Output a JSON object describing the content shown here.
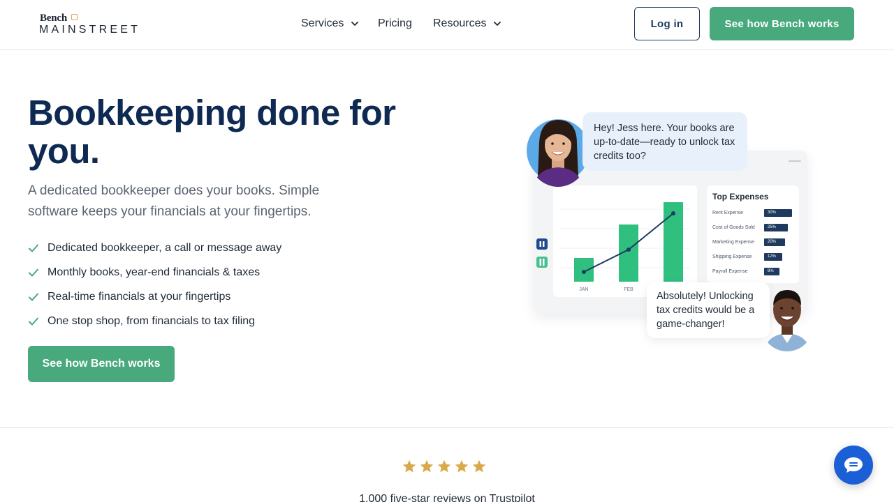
{
  "brand": {
    "top": "Bench",
    "bottom": "MAINSTREET"
  },
  "nav": {
    "services": "Services",
    "pricing": "Pricing",
    "resources": "Resources"
  },
  "header": {
    "login_label": "Log in",
    "cta_label": "See how Bench works"
  },
  "hero": {
    "title": "Bookkeeping done for you.",
    "subtitle": "A dedicated bookkeeper does your books. Simple software keeps your financials at your fingertips.",
    "features": [
      "Dedicated bookkeeper, a call or message away",
      "Monthly books, year-end financials & taxes",
      "Real-time financials at your fingertips",
      "One stop shop, from financials to tax filing"
    ],
    "cta_label": "See how Bench works"
  },
  "illustration": {
    "jess_message": "Hey! Jess here. Your books are up-to-date—ready to unlock tax credits too?",
    "reply_message": "Absolutely! Unlocking tax credits would be a game-changer!",
    "chart_labels": [
      "JAN",
      "FEB"
    ],
    "expenses_title": "Top Expenses",
    "expenses": [
      {
        "label": "Rent Expense",
        "pct": "30%"
      },
      {
        "label": "Cost of Goods Sold",
        "pct": "25%"
      },
      {
        "label": "Marketing Expense",
        "pct": "20%"
      },
      {
        "label": "Shipping Expense",
        "pct": "12%"
      },
      {
        "label": "Payroll Expense",
        "pct": "8%"
      }
    ]
  },
  "reviews": {
    "rating": 5,
    "rating_max": 5,
    "text": "1,000 five-star reviews on Trustpilot"
  },
  "colors": {
    "brand_green": "#47a97c",
    "navy": "#0e2a52",
    "star_gold": "#d9a94a",
    "chat_blue": "#1a5fd6"
  },
  "icons": {
    "chat": "chat-bubble-icon",
    "check": "check-icon",
    "chevron": "chevron-down-icon",
    "star": "star-icon"
  }
}
